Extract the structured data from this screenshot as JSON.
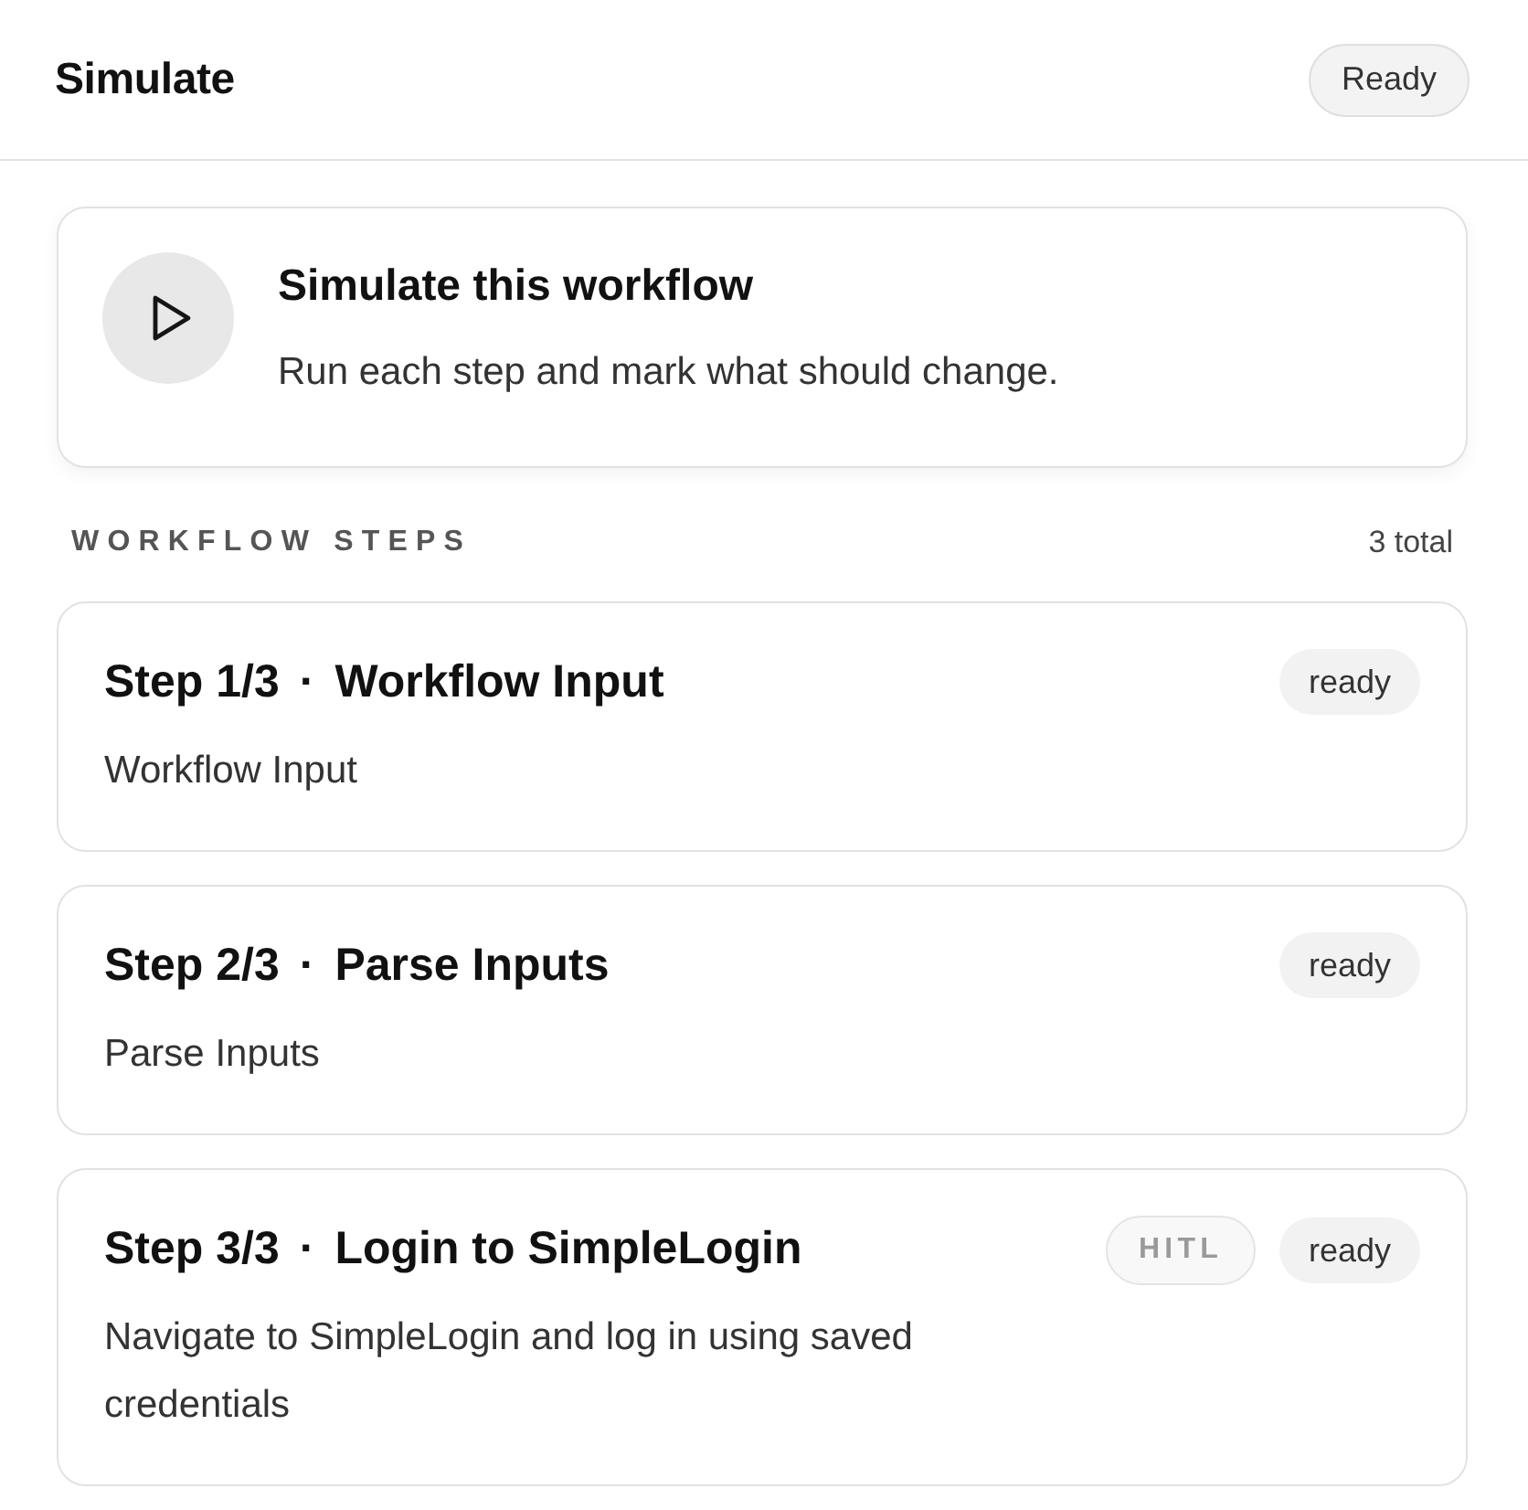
{
  "header": {
    "title": "Simulate",
    "status": "Ready"
  },
  "hero": {
    "title": "Simulate this workflow",
    "description": "Run each step and mark what should change."
  },
  "section": {
    "label": "WORKFLOW STEPS",
    "count": "3 total"
  },
  "steps": [
    {
      "number": "Step 1/3",
      "separator": "·",
      "name": "Workflow Input",
      "description": "Workflow Input",
      "badges": [
        {
          "kind": "status",
          "label": "ready"
        }
      ]
    },
    {
      "number": "Step 2/3",
      "separator": "·",
      "name": "Parse Inputs",
      "description": "Parse Inputs",
      "badges": [
        {
          "kind": "status",
          "label": "ready"
        }
      ]
    },
    {
      "number": "Step 3/3",
      "separator": "·",
      "name": "Login to SimpleLogin",
      "description": "Navigate to SimpleLogin and log in using saved credentials",
      "badges": [
        {
          "kind": "tag",
          "label": "HITL"
        },
        {
          "kind": "status",
          "label": "ready"
        }
      ]
    }
  ]
}
